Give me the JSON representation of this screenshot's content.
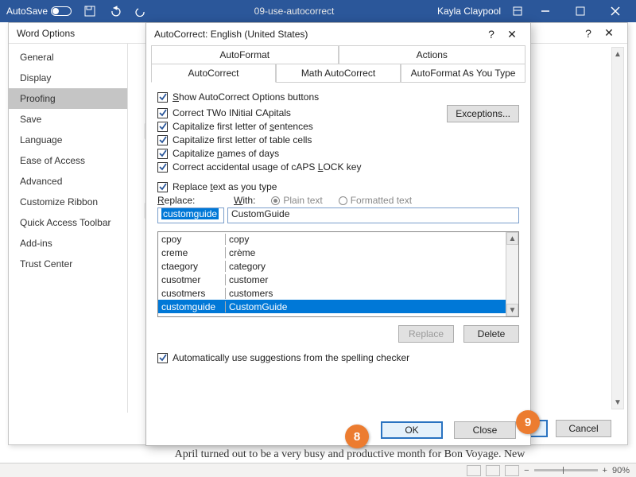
{
  "titlebar": {
    "autosave_label": "AutoSave",
    "doc_name": "09-use-autocorrect",
    "user": "Kayla Claypool"
  },
  "word_options": {
    "title": "Word Options",
    "nav": [
      "General",
      "Display",
      "Proofing",
      "Save",
      "Language",
      "Ease of Access",
      "Advanced",
      "Customize Ribbon",
      "Quick Access Toolbar",
      "Add-ins",
      "Trust Center"
    ],
    "selected": "Proofing",
    "ok": "OK",
    "cancel": "Cancel"
  },
  "ac": {
    "title": "AutoCorrect: English (United States)",
    "tabs_top": [
      "AutoFormat",
      "Actions"
    ],
    "tabs_bottom": [
      "AutoCorrect",
      "Math AutoCorrect",
      "AutoFormat As You Type"
    ],
    "show_buttons": "Show AutoCorrect Options buttons",
    "correct_caps": "Correct TWo INitial CApitals",
    "cap_sentence": "Capitalize first letter of sentences",
    "cap_cells": "Capitalize first letter of table cells",
    "cap_days": "Capitalize names of days",
    "caps_lock": "Correct accidental usage of cAPS LOCK key",
    "exceptions": "Exceptions...",
    "replace_as_type": "Replace text as you type",
    "replace_lbl": "Replace:",
    "with_lbl": "With:",
    "plain": "Plain text",
    "formatted": "Formatted text",
    "replace_val": "customguide",
    "with_val": "CustomGuide",
    "list": [
      {
        "a": "cpoy",
        "b": "copy"
      },
      {
        "a": "creme",
        "b": "crème"
      },
      {
        "a": "ctaegory",
        "b": "category"
      },
      {
        "a": "cusotmer",
        "b": "customer"
      },
      {
        "a": "cusotmers",
        "b": "customers"
      },
      {
        "a": "customguide",
        "b": "CustomGuide"
      }
    ],
    "btn_replace": "Replace",
    "btn_delete": "Delete",
    "auto_suggest": "Automatically use suggestions from the spelling checker",
    "ok": "OK",
    "close": "Close"
  },
  "callouts": {
    "c8": "8",
    "c9": "9"
  },
  "docline": "April turned out to be a very busy and productive month for Bon Voyage. New",
  "status": {
    "zoom": "90%",
    "plus": "+",
    "minus": "−"
  }
}
